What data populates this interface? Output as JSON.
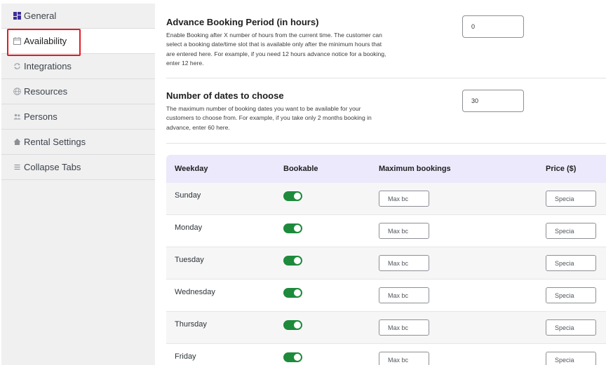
{
  "sidebar": {
    "items": [
      {
        "label": "General",
        "icon": "grid-icon"
      },
      {
        "label": "Availability",
        "icon": "calendar-icon"
      },
      {
        "label": "Integrations",
        "icon": "sync-icon"
      },
      {
        "label": "Resources",
        "icon": "globe-icon"
      },
      {
        "label": "Persons",
        "icon": "people-icon"
      },
      {
        "label": "Rental Settings",
        "icon": "home-icon"
      },
      {
        "label": "Collapse Tabs",
        "icon": "menu-icon"
      }
    ],
    "active_index": 1
  },
  "advance_booking": {
    "title": "Advance Booking Period (in hours)",
    "description": "Enable Booking after X number of hours from the current time. The customer can select a booking date/time slot that is available only after the minimum hours that are entered here. For example, if you need 12 hours advance notice for a booking, enter 12 here.",
    "value": "0"
  },
  "dates_to_choose": {
    "title": "Number of dates to choose",
    "description": "The maximum number of booking dates you want to be available for your customers to choose from. For example, if you take only 2 months booking in advance, enter 60 here.",
    "value": "30"
  },
  "table": {
    "headers": {
      "weekday": "Weekday",
      "bookable": "Bookable",
      "max_bookings": "Maximum bookings",
      "price": "Price ($)"
    },
    "max_placeholder": "Max bc",
    "price_placeholder": "Specia",
    "rows": [
      {
        "day": "Sunday",
        "bookable": true
      },
      {
        "day": "Monday",
        "bookable": true
      },
      {
        "day": "Tuesday",
        "bookable": true
      },
      {
        "day": "Wednesday",
        "bookable": true
      },
      {
        "day": "Thursday",
        "bookable": true
      },
      {
        "day": "Friday",
        "bookable": true
      }
    ]
  },
  "colors": {
    "accent": "#3c2e9b",
    "toggle_on": "#1e8a3c",
    "highlight": "#e01b24",
    "header_bg": "#ebe9fb"
  }
}
